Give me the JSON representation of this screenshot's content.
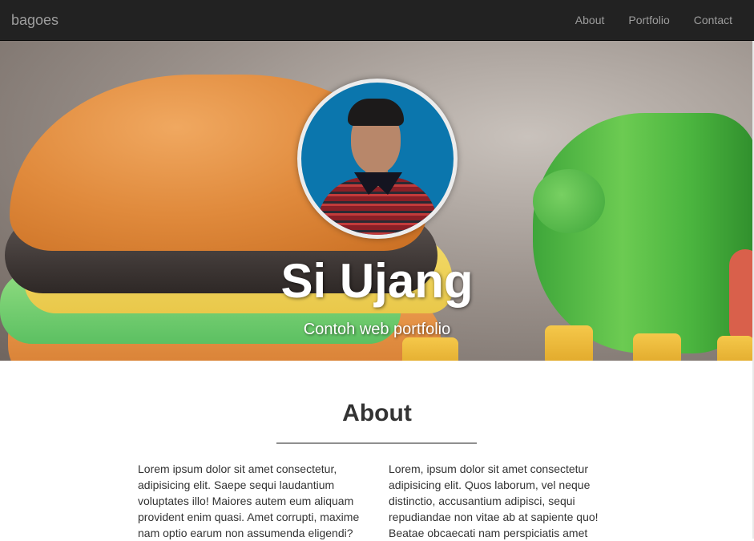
{
  "navbar": {
    "brand": "bagoes",
    "links": [
      "About",
      "Portfolio",
      "Contact"
    ]
  },
  "hero": {
    "title": "Si Ujang",
    "subtitle": "Contoh web portfolio"
  },
  "about": {
    "heading": "About",
    "left_text": "Lorem ipsum dolor sit amet consectetur, adipisicing elit. Saepe sequi laudantium voluptates illo! Maiores autem eum aliquam provident enim quasi. Amet corrupti, maxime nam optio earum non assumenda eligendi?",
    "right_text": "Lorem, ipsum dolor sit amet consectetur adipisicing elit. Quos laborum, vel neque distinctio, accusantium adipisci, sequi repudiandae non vitae ab at sapiente quo! Beatae obcaecati nam perspiciatis amet"
  },
  "colors": {
    "navbar_bg": "#222222",
    "nav_text": "#9d9d9d",
    "avatar_bg": "#0b76ad"
  }
}
